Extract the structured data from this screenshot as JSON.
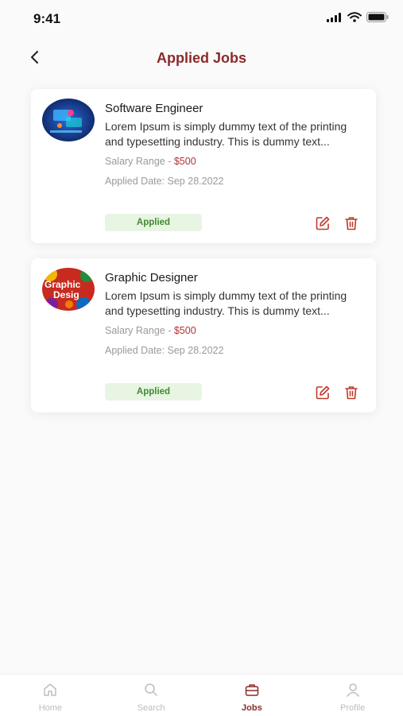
{
  "status_bar": {
    "time": "9:41"
  },
  "header": {
    "title": "Applied Jobs"
  },
  "jobs": [
    {
      "title": "Software Engineer",
      "description": "Lorem Ipsum is simply dummy text of the printing and typesetting industry. This is dummy text...",
      "salary_label": "Salary Range - ",
      "salary_value": "$500",
      "applied_date": "Applied Date: Sep 28.2022",
      "status": "Applied"
    },
    {
      "title": "Graphic Designer",
      "description": "Lorem Ipsum is simply dummy text of the printing and typesetting industry. This is dummy text...",
      "salary_label": "Salary Range - ",
      "salary_value": "$500",
      "applied_date": "Applied Date: Sep 28.2022",
      "status": "Applied",
      "avatar_text": "Graphic Desig"
    }
  ],
  "bottom_nav": {
    "items": [
      {
        "label": "Home",
        "icon": "home-icon"
      },
      {
        "label": "Search",
        "icon": "search-icon"
      },
      {
        "label": "Jobs",
        "icon": "briefcase-icon",
        "active": true
      },
      {
        "label": "Profile",
        "icon": "user-icon"
      }
    ]
  },
  "colors": {
    "brand": "#8a2a2a",
    "danger": "#c0392b",
    "badge_bg": "#e8f5e3",
    "badge_text": "#3f8a2f"
  }
}
